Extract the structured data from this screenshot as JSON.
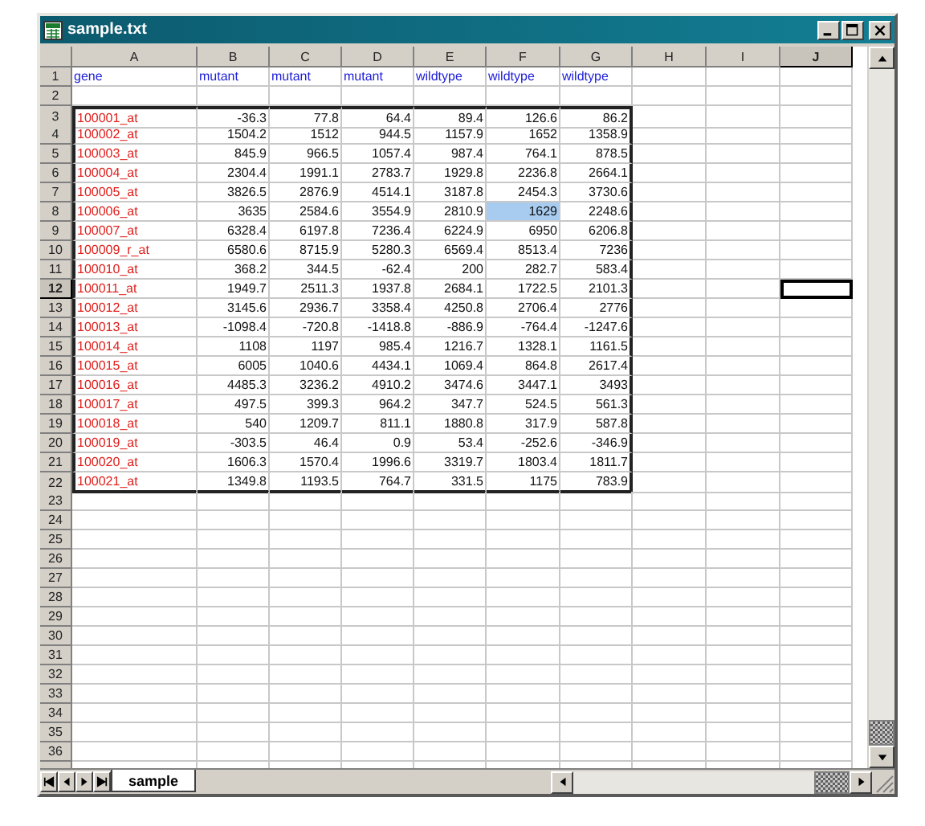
{
  "window": {
    "title": "sample.txt"
  },
  "columns": [
    {
      "label": "A",
      "active": false
    },
    {
      "label": "B",
      "active": false
    },
    {
      "label": "C",
      "active": false
    },
    {
      "label": "D",
      "active": false
    },
    {
      "label": "E",
      "active": false
    },
    {
      "label": "F",
      "active": false
    },
    {
      "label": "G",
      "active": false
    },
    {
      "label": "H",
      "active": false
    },
    {
      "label": "I",
      "active": false
    },
    {
      "label": "J",
      "active": true
    }
  ],
  "rows": [
    {
      "number": "1",
      "kind": "header",
      "active": false,
      "cells": [
        "gene",
        "mutant",
        "mutant",
        "mutant",
        "wildtype",
        "wildtype",
        "wildtype"
      ]
    },
    {
      "number": "2",
      "kind": "empty",
      "active": false
    },
    {
      "number": "3",
      "kind": "data",
      "active": false,
      "gene": "100001_at",
      "values": [
        "-36.3",
        "77.8",
        "64.4",
        "89.4",
        "126.6",
        "86.2"
      ],
      "selected": [
        false,
        false,
        false,
        false,
        false,
        false
      ]
    },
    {
      "number": "4",
      "kind": "data",
      "active": false,
      "gene": "100002_at",
      "values": [
        "1504.2",
        "1512",
        "944.5",
        "1157.9",
        "1652",
        "1358.9"
      ],
      "selected": [
        false,
        false,
        false,
        false,
        false,
        false
      ]
    },
    {
      "number": "5",
      "kind": "data",
      "active": false,
      "gene": "100003_at",
      "values": [
        "845.9",
        "966.5",
        "1057.4",
        "987.4",
        "764.1",
        "878.5"
      ],
      "selected": [
        false,
        false,
        false,
        false,
        false,
        false
      ]
    },
    {
      "number": "6",
      "kind": "data",
      "active": false,
      "gene": "100004_at",
      "values": [
        "2304.4",
        "1991.1",
        "2783.7",
        "1929.8",
        "2236.8",
        "2664.1"
      ],
      "selected": [
        false,
        false,
        false,
        false,
        false,
        false
      ]
    },
    {
      "number": "7",
      "kind": "data",
      "active": false,
      "gene": "100005_at",
      "values": [
        "3826.5",
        "2876.9",
        "4514.1",
        "3187.8",
        "2454.3",
        "3730.6"
      ],
      "selected": [
        false,
        false,
        false,
        false,
        false,
        false
      ]
    },
    {
      "number": "8",
      "kind": "data",
      "active": false,
      "gene": "100006_at",
      "values": [
        "3635",
        "2584.6",
        "3554.9",
        "2810.9",
        "1629",
        "2248.6"
      ],
      "selected": [
        false,
        false,
        false,
        false,
        true,
        false
      ]
    },
    {
      "number": "9",
      "kind": "data",
      "active": false,
      "gene": "100007_at",
      "values": [
        "6328.4",
        "6197.8",
        "7236.4",
        "6224.9",
        "6950",
        "6206.8"
      ],
      "selected": [
        false,
        false,
        false,
        false,
        false,
        false
      ]
    },
    {
      "number": "10",
      "kind": "data",
      "active": false,
      "gene": "100009_r_at",
      "values": [
        "6580.6",
        "8715.9",
        "5280.3",
        "6569.4",
        "8513.4",
        "7236"
      ],
      "selected": [
        false,
        false,
        false,
        false,
        false,
        false
      ]
    },
    {
      "number": "11",
      "kind": "data",
      "active": false,
      "gene": "100010_at",
      "values": [
        "368.2",
        "344.5",
        "-62.4",
        "200",
        "282.7",
        "583.4"
      ],
      "selected": [
        false,
        false,
        false,
        false,
        false,
        false
      ]
    },
    {
      "number": "12",
      "kind": "data",
      "active": true,
      "gene": "100011_at",
      "values": [
        "1949.7",
        "2511.3",
        "1937.8",
        "2684.1",
        "1722.5",
        "2101.3"
      ],
      "selected": [
        false,
        false,
        false,
        false,
        false,
        false
      ]
    },
    {
      "number": "13",
      "kind": "data",
      "active": false,
      "gene": "100012_at",
      "values": [
        "3145.6",
        "2936.7",
        "3358.4",
        "4250.8",
        "2706.4",
        "2776"
      ],
      "selected": [
        false,
        false,
        false,
        false,
        false,
        false
      ]
    },
    {
      "number": "14",
      "kind": "data",
      "active": false,
      "gene": "100013_at",
      "values": [
        "-1098.4",
        "-720.8",
        "-1418.8",
        "-886.9",
        "-764.4",
        "-1247.6"
      ],
      "selected": [
        false,
        false,
        false,
        false,
        false,
        false
      ]
    },
    {
      "number": "15",
      "kind": "data",
      "active": false,
      "gene": "100014_at",
      "values": [
        "1108",
        "1197",
        "985.4",
        "1216.7",
        "1328.1",
        "1161.5"
      ],
      "selected": [
        false,
        false,
        false,
        false,
        false,
        false
      ]
    },
    {
      "number": "16",
      "kind": "data",
      "active": false,
      "gene": "100015_at",
      "values": [
        "6005",
        "1040.6",
        "4434.1",
        "1069.4",
        "864.8",
        "2617.4"
      ],
      "selected": [
        false,
        false,
        false,
        false,
        false,
        false
      ]
    },
    {
      "number": "17",
      "kind": "data",
      "active": false,
      "gene": "100016_at",
      "values": [
        "4485.3",
        "3236.2",
        "4910.2",
        "3474.6",
        "3447.1",
        "3493"
      ],
      "selected": [
        false,
        false,
        false,
        false,
        false,
        false
      ]
    },
    {
      "number": "18",
      "kind": "data",
      "active": false,
      "gene": "100017_at",
      "values": [
        "497.5",
        "399.3",
        "964.2",
        "347.7",
        "524.5",
        "561.3"
      ],
      "selected": [
        false,
        false,
        false,
        false,
        false,
        false
      ]
    },
    {
      "number": "19",
      "kind": "data",
      "active": false,
      "gene": "100018_at",
      "values": [
        "540",
        "1209.7",
        "811.1",
        "1880.8",
        "317.9",
        "587.8"
      ],
      "selected": [
        false,
        false,
        false,
        false,
        false,
        false
      ]
    },
    {
      "number": "20",
      "kind": "data",
      "active": false,
      "gene": "100019_at",
      "values": [
        "-303.5",
        "46.4",
        "0.9",
        "53.4",
        "-252.6",
        "-346.9"
      ],
      "selected": [
        false,
        false,
        false,
        false,
        false,
        false
      ]
    },
    {
      "number": "21",
      "kind": "data",
      "active": false,
      "gene": "100020_at",
      "values": [
        "1606.3",
        "1570.4",
        "1996.6",
        "3319.7",
        "1803.4",
        "1811.7"
      ],
      "selected": [
        false,
        false,
        false,
        false,
        false,
        false
      ]
    },
    {
      "number": "22",
      "kind": "data",
      "active": false,
      "gene": "100021_at",
      "values": [
        "1349.8",
        "1193.5",
        "764.7",
        "331.5",
        "1175",
        "783.9"
      ],
      "selected": [
        false,
        false,
        false,
        false,
        false,
        false
      ]
    },
    {
      "number": "23",
      "kind": "empty",
      "active": false
    },
    {
      "number": "24",
      "kind": "empty",
      "active": false
    },
    {
      "number": "25",
      "kind": "empty",
      "active": false
    },
    {
      "number": "26",
      "kind": "empty",
      "active": false
    },
    {
      "number": "27",
      "kind": "empty",
      "active": false
    },
    {
      "number": "28",
      "kind": "empty",
      "active": false
    },
    {
      "number": "29",
      "kind": "empty",
      "active": false
    },
    {
      "number": "30",
      "kind": "empty",
      "active": false
    },
    {
      "number": "31",
      "kind": "empty",
      "active": false
    },
    {
      "number": "32",
      "kind": "empty",
      "active": false
    },
    {
      "number": "33",
      "kind": "empty",
      "active": false
    },
    {
      "number": "34",
      "kind": "empty",
      "active": false
    },
    {
      "number": "35",
      "kind": "empty",
      "active": false
    },
    {
      "number": "36",
      "kind": "empty",
      "active": false
    }
  ],
  "sheet_tabs": [
    {
      "label": "sample",
      "selected": true
    }
  ]
}
